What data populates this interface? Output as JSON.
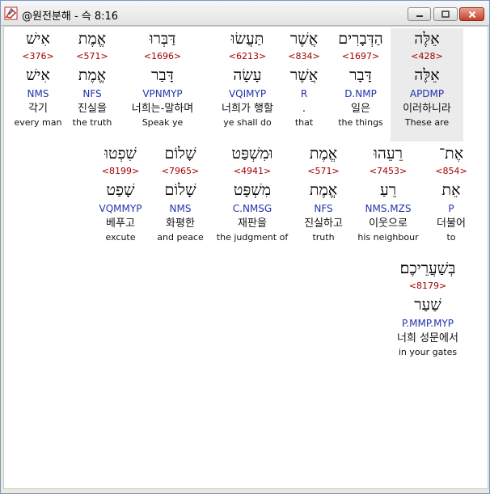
{
  "window": {
    "title": "@원전분해 - 슥 8:16"
  },
  "lines": [
    [
      {
        "heb": "אֵלֶּה",
        "strong": "<428>",
        "lemma": "אֵלֶּה",
        "morph": "APDMP",
        "kor": "이러하니라",
        "eng": "These are",
        "selected": true
      },
      {
        "heb": "הַדְּבָרִים",
        "strong": "<1697>",
        "lemma": "דָּבָר",
        "morph": "D.NMP",
        "kor": "일은",
        "eng": "the things"
      },
      {
        "heb": "אֲשֶׁר",
        "strong": "<834>",
        "lemma": "אֲשֶׁר",
        "morph": "R",
        "kor": ".",
        "eng": "that"
      },
      {
        "heb": "תַּעֲשׂוּ",
        "strong": "<6213>",
        "lemma": "עָשָׂה",
        "morph": "VQIMYP",
        "kor": "너희가 행할",
        "eng": "ye shall do"
      },
      {
        "heb": "דַּבְּרוּ",
        "strong": "<1696>",
        "lemma": "דָּבַר",
        "morph": "VPNMYP",
        "kor": "너희는-말하며",
        "eng": "Speak ye"
      },
      {
        "heb": "אֱמֶת",
        "strong": "<571>",
        "lemma": "אֱמֶת",
        "morph": "NFS",
        "kor": "진실을",
        "eng": "the truth"
      },
      {
        "heb": "אִישׁ",
        "strong": "<376>",
        "lemma": "אִישׁ",
        "morph": "NMS",
        "kor": "각기",
        "eng": "every man"
      }
    ],
    [
      {
        "heb": "אֶת־",
        "strong": "<854>",
        "lemma": "אֵת",
        "morph": "P",
        "kor": "더불어",
        "eng": "to"
      },
      {
        "heb": "רֵעֵהוּ",
        "strong": "<7453>",
        "lemma": "רֵעַ",
        "morph": "NMS.MZS",
        "kor": "이웃으로",
        "eng": "his neighbour"
      },
      {
        "heb": "אֱמֶת",
        "strong": "<571>",
        "lemma": "אֱמֶת",
        "morph": "NFS",
        "kor": "진실하고",
        "eng": "truth"
      },
      {
        "heb": "וּמִשְׁפַּט",
        "strong": "<4941>",
        "lemma": "מִשְׁפָּט",
        "morph": "C.NMSG",
        "kor": "재판을",
        "eng": "the judgment of"
      },
      {
        "heb": "שָׁלוֹם",
        "strong": "<7965>",
        "lemma": "שָׁלוֹם",
        "morph": "NMS",
        "kor": "화평한",
        "eng": "and peace"
      },
      {
        "heb": "שִׁפְטוּ",
        "strong": "<8199>",
        "lemma": "שָׁפַט",
        "morph": "VQMMYP",
        "kor": "베푸고",
        "eng": "excute"
      }
    ],
    [
      {
        "heb": "בְּשַׁעֲרֵיכֶם׃",
        "strong": "<8179>",
        "lemma": "שַׁעַר",
        "morph": "P.MMP.MYP",
        "kor": "너희 성문에서",
        "eng": "in your gates"
      }
    ]
  ]
}
